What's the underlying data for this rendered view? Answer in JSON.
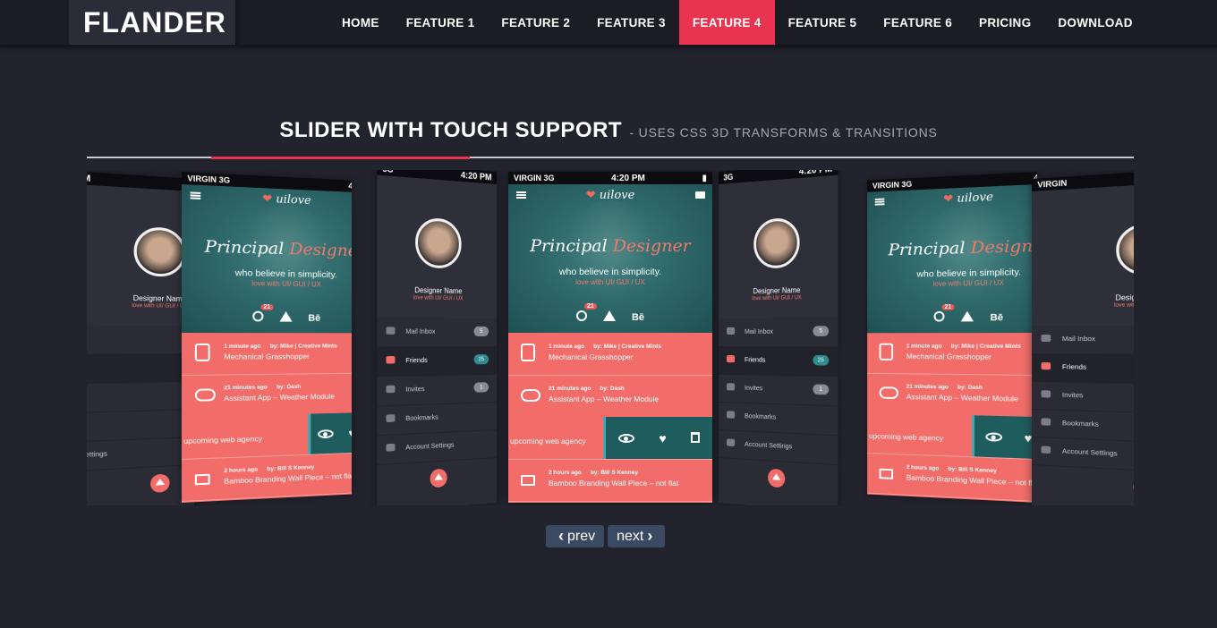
{
  "brand": {
    "logo": "FLANDER"
  },
  "nav": {
    "items": [
      {
        "label": "HOME"
      },
      {
        "label": "FEATURE 1"
      },
      {
        "label": "FEATURE 2"
      },
      {
        "label": "FEATURE 3"
      },
      {
        "label": "FEATURE 4",
        "active": true
      },
      {
        "label": "FEATURE 5"
      },
      {
        "label": "FEATURE 6"
      },
      {
        "label": "PRICING"
      },
      {
        "label": "DOWNLOAD"
      }
    ]
  },
  "section": {
    "title": "SLIDER WITH TOUCH SUPPORT",
    "subtitle": "- USES CSS 3D TRANSFORMS & TRANSITIONS"
  },
  "phone": {
    "carrier": "VIRGIN  3G",
    "time": "4:20 PM",
    "app_brand": "uilove",
    "title_part1": "Principal ",
    "title_part2": "Designer",
    "tagline": "who believe in simplicity.",
    "tagline_sub": "love with UI/ GUI / UX",
    "dribbble_badge": "21",
    "behance_label": "Bē",
    "feed": [
      {
        "time": "1 minute ago",
        "by": "by: Mike | Creative Mints",
        "text": "Mechanical Grasshopper"
      },
      {
        "time": "21 minutes ago",
        "by": "by: Dash",
        "text": "Assistant App – Weather Module"
      },
      {
        "time": "",
        "by": "",
        "text": "upcoming web agency"
      },
      {
        "time": "2 hours ago",
        "by": "by: Bill S Kenney",
        "text": "Bamboo Branding Wall Piece – not flat"
      }
    ]
  },
  "menu": {
    "designer_name": "Designer Name",
    "designer_sub": "love with UI/ GUI / UX",
    "items": [
      {
        "label": "Mail Inbox",
        "count": "5"
      },
      {
        "label": "Friends",
        "count": "25",
        "selected": true
      },
      {
        "label": "Invites",
        "count": "1"
      },
      {
        "label": "Bookmarks",
        "count": ""
      },
      {
        "label": "Account Settings",
        "count": ""
      }
    ]
  },
  "pager": {
    "prev": "prev",
    "next": "next"
  },
  "colors": {
    "accent": "#e8344e",
    "coral": "#f26d69",
    "teal": "#2c6466",
    "bg": "#23232e"
  }
}
